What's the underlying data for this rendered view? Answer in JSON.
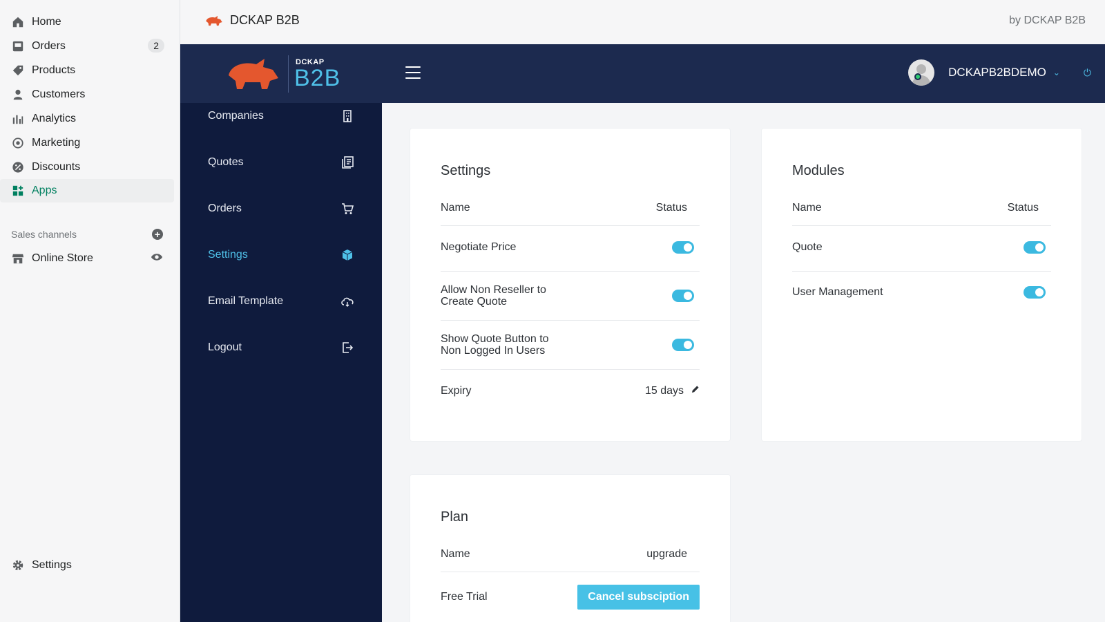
{
  "admin_nav": {
    "items": [
      {
        "label": "Home",
        "icon": "home-icon"
      },
      {
        "label": "Orders",
        "icon": "orders-icon",
        "badge": "2"
      },
      {
        "label": "Products",
        "icon": "tag-icon"
      },
      {
        "label": "Customers",
        "icon": "person-icon"
      },
      {
        "label": "Analytics",
        "icon": "bar-chart-icon"
      },
      {
        "label": "Marketing",
        "icon": "target-icon"
      },
      {
        "label": "Discounts",
        "icon": "discount-icon"
      },
      {
        "label": "Apps",
        "icon": "apps-icon",
        "active": true
      }
    ],
    "sales_channels_heading": "Sales channels",
    "online_store_label": "Online Store",
    "settings_label": "Settings"
  },
  "topbar": {
    "app_title": "DCKAP B2B",
    "by_text": "by DCKAP B2B"
  },
  "header": {
    "brand_small": "DCKAP",
    "brand_big": "B2B",
    "username": "DCKAPB2BDEMO"
  },
  "app_menu": {
    "items": [
      {
        "label": "Companies",
        "icon": "building-icon"
      },
      {
        "label": "Quotes",
        "icon": "documents-icon"
      },
      {
        "label": "Orders",
        "icon": "cart-icon"
      },
      {
        "label": "Settings",
        "icon": "box-icon",
        "active": true
      },
      {
        "label": "Email Template",
        "icon": "cloud-icon"
      },
      {
        "label": "Logout",
        "icon": "logout-icon"
      }
    ]
  },
  "settings_card": {
    "title": "Settings",
    "col_name": "Name",
    "col_status": "Status",
    "rows": [
      {
        "name": "Negotiate Price",
        "enabled": true
      },
      {
        "name_line1": "Allow Non Reseller to",
        "name_line2": "Create Quote",
        "enabled": true
      },
      {
        "name_line1": "Show Quote Button to",
        "name_line2": "Non Logged In Users",
        "enabled": true
      }
    ],
    "expiry_label": "Expiry",
    "expiry_value": "15 days"
  },
  "modules_card": {
    "title": "Modules",
    "col_name": "Name",
    "col_status": "Status",
    "rows": [
      {
        "name": "Quote",
        "enabled": true
      },
      {
        "name": "User Management",
        "enabled": true
      }
    ]
  },
  "plan_card": {
    "title": "Plan",
    "col_name": "Name",
    "upgrade_label": "upgrade",
    "plan_name": "Free Trial",
    "cancel_label": "Cancel subsciption"
  },
  "colors": {
    "accent": "#3bb9e0",
    "header_bg": "#1c2a4f",
    "menu_bg": "#0f1b3d",
    "shopify_green": "#008060",
    "brand_orange": "#e4572e"
  }
}
